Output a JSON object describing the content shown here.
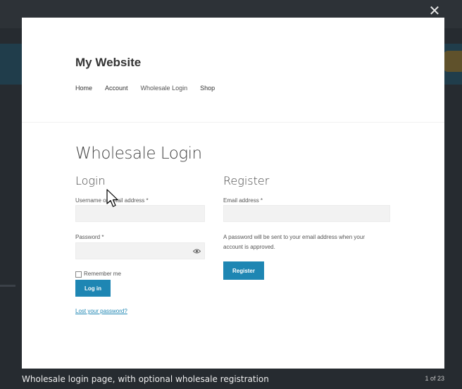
{
  "lightbox": {
    "close_icon": "close-icon",
    "caption": "Wholesale login page, with optional wholesale registration",
    "counter": "1 of 23"
  },
  "site": {
    "title": "My Website",
    "nav": [
      "Home",
      "Account",
      "Wholesale Login",
      "Shop"
    ]
  },
  "page": {
    "heading": "Wholesale Login",
    "login": {
      "heading": "Login",
      "username_label": "Username or email address *",
      "username_value": "",
      "password_label": "Password *",
      "password_value": "",
      "show_password_icon": "eye-icon",
      "remember_label": "Remember me",
      "remember_checked": false,
      "submit_label": "Log in",
      "lost_password": "Lost your password?"
    },
    "register": {
      "heading": "Register",
      "email_label": "Email address *",
      "email_value": "",
      "note": "A password will be sent to your email address when your account is approved.",
      "submit_label": "Register"
    }
  },
  "colors": {
    "accent": "#1e86b3",
    "overlay": "#262b30",
    "frame": "#ffffff"
  }
}
